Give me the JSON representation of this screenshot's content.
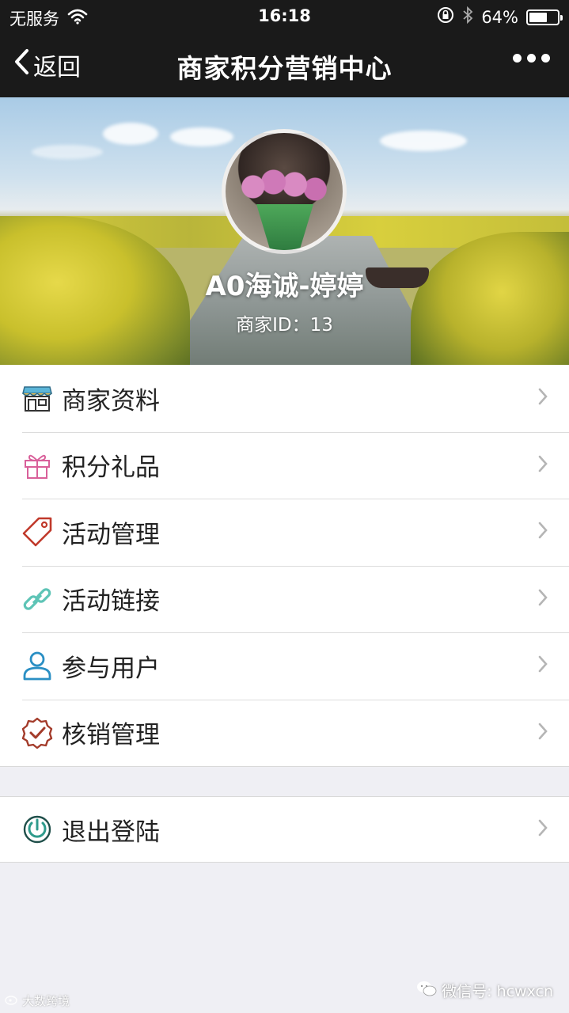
{
  "status_bar": {
    "carrier": "无服务",
    "time": "16:18",
    "battery": "64%",
    "battery_level": 0.64
  },
  "nav": {
    "back_label": "返回",
    "title": "商家积分营销中心"
  },
  "profile": {
    "name": "A0海诚-婷婷",
    "merchant_id": "商家ID：13"
  },
  "menu": [
    {
      "label": "商家资料",
      "icon": "store-icon"
    },
    {
      "label": "积分礼品",
      "icon": "gift-icon"
    },
    {
      "label": "活动管理",
      "icon": "tag-icon"
    },
    {
      "label": "活动链接",
      "icon": "link-icon"
    },
    {
      "label": "参与用户",
      "icon": "user-icon"
    },
    {
      "label": "核销管理",
      "icon": "badge-check-icon"
    }
  ],
  "logout": {
    "label": "退出登陆",
    "icon": "power-icon"
  },
  "watermark": {
    "left": "大数跨境",
    "right": "微信号: hcwxcn"
  },
  "colors": {
    "bar_bg": "#1a1a1a",
    "page_bg": "#efeff4",
    "icon_store": "#3a8fb7",
    "icon_gift": "#d9609a",
    "icon_tag": "#c0392b",
    "icon_link": "#5ec4b6",
    "icon_user": "#2a8fc4",
    "icon_check": "#a33b2a",
    "icon_power": "#2e9b8c"
  }
}
